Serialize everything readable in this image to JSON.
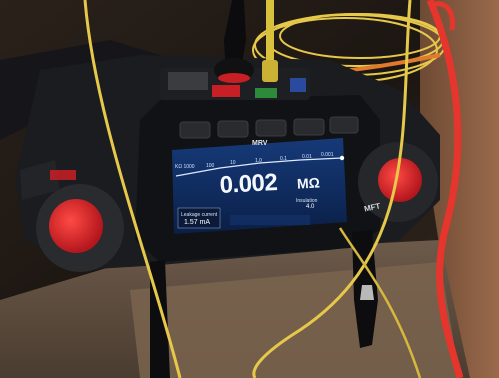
{
  "screen": {
    "mode_label": "MRV",
    "scale_ticks": [
      "KΩ 1000",
      "100",
      "10",
      "1.0",
      "0.1",
      "0.01",
      "0.001"
    ],
    "reading_value": "0.002",
    "reading_unit": "MΩ",
    "lead_label": "Leakage current",
    "lead_value": "1.57 mA",
    "right_label": "Insulation",
    "right_value": "4.0"
  },
  "device": {
    "brand_text": "MFT"
  },
  "colors": {
    "screen_bg": "#0f2a5c",
    "case": "#1b1c1f",
    "knob_red": "#d8232a",
    "cable_yellow": "#e6c84a",
    "cable_red": "#e5352c"
  }
}
